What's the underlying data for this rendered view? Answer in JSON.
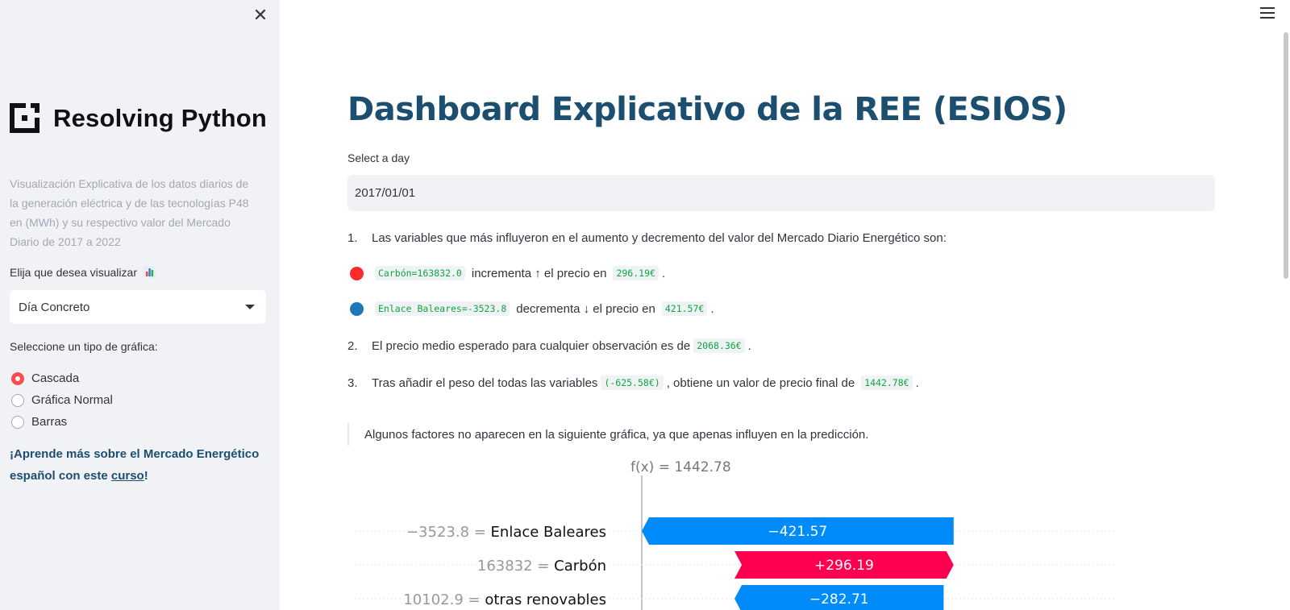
{
  "sidebar": {
    "close_icon": "close-icon",
    "logo_text": "Resolving Python",
    "description": "Visualización Explicativa de los datos diarios de la generación eléctrica y de las tecnologías P48 en (MWh) y su respectivo valor del Mercado Diario de 2017 a 2022",
    "select_label": "Elija que desea visualizar",
    "select_value": "Día Concreto",
    "chart_type_label": "Seleccione un tipo de gráfica:",
    "radio_options": [
      "Cascada",
      "Gráfica Normal",
      "Barras"
    ],
    "radio_selected": "Cascada",
    "cta_text": "¡Aprende más sobre el Mercado Energético español con este ",
    "cta_link": "curso",
    "cta_end": "!"
  },
  "main": {
    "title": "Dashboard Explicativo de la REE (ESIOS)",
    "day_label": "Select a day",
    "day_value": "2017/01/01",
    "item1_num": "1.",
    "item1_text": "Las variables que más influyeron en el aumento y decremento del valor del Mercado Diario Energético son:",
    "var1_code": "Carbón=163832.0",
    "var1_mid": "incrementa ↑ el precio en",
    "var1_value": "296.19€",
    "var2_code": "Enlace Baleares=-3523.8",
    "var2_mid": "decrementa ↓ el precio en",
    "var2_value": "421.57€",
    "item2_num": "2.",
    "item2_text": "El precio medio esperado para cualquier observación es de",
    "item2_value": "2068.36€",
    "item3_num": "3.",
    "item3_text": "Tras añadir el peso del todas las variables",
    "item3_weight": "(-625.58€)",
    "item3_mid": ", obtiene un valor de precio final de",
    "item3_value": "1442.78€",
    "period": ".",
    "note": "Algunos factores no aparecen en la siguiente gráfica, ya que apenas influyen en la predicción."
  },
  "colors": {
    "accent": "#ff4b4b",
    "title": "#1c4e6f",
    "positive": "#ff0051",
    "negative": "#008bfb",
    "code_green": "#09ab3b"
  },
  "chart_data": {
    "type": "bar",
    "fx_label": "f(x) = 1442.78",
    "fx_value": 1442.78,
    "rows": [
      {
        "feature_value": "−3523.8",
        "feature": "Enlace Baleares",
        "contribution": -421.57,
        "label": "−421.57"
      },
      {
        "feature_value": "163832",
        "feature": "Carbón",
        "contribution": 296.19,
        "label": "+296.19"
      },
      {
        "feature_value": "10102.9",
        "feature": "otras renovables",
        "contribution": -282.71,
        "label": "−282.71"
      }
    ]
  }
}
